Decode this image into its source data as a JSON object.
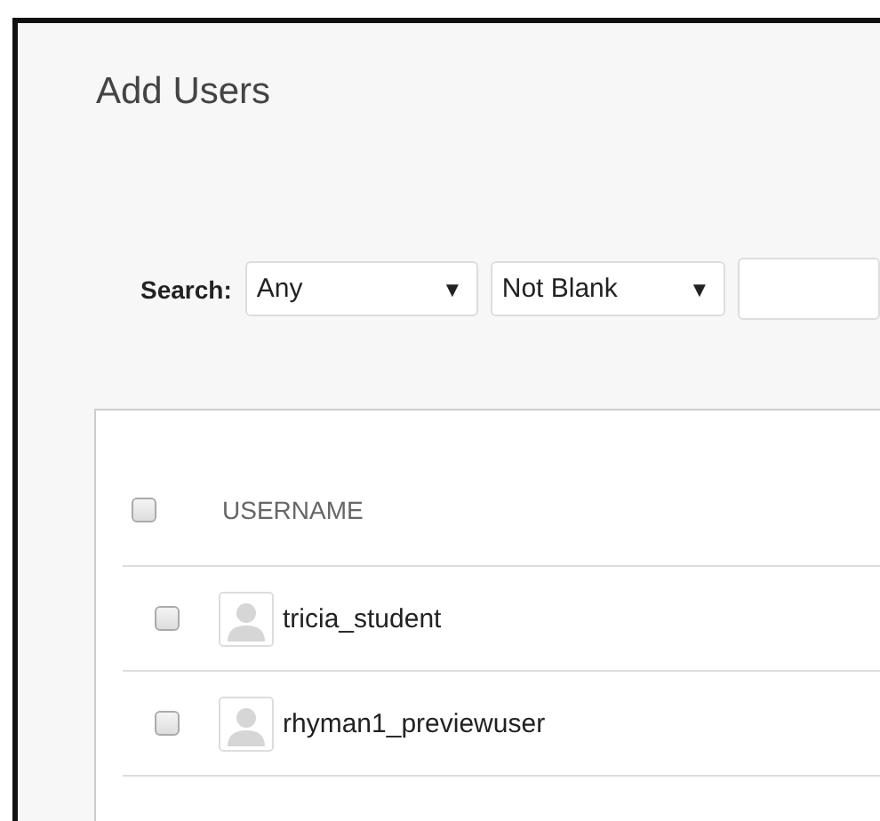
{
  "title": "Add Users",
  "search": {
    "label": "Search:",
    "field_select": {
      "value": "Any",
      "arrow": "▼"
    },
    "operator_select": {
      "value": "Not Blank",
      "arrow": "▼"
    }
  },
  "table": {
    "select_all": {
      "checked": false
    },
    "columns": [
      "USERNAME"
    ],
    "rows": [
      {
        "username": "tricia_student",
        "checked": false
      },
      {
        "username": "rhyman1_previewuser",
        "checked": false
      }
    ]
  }
}
